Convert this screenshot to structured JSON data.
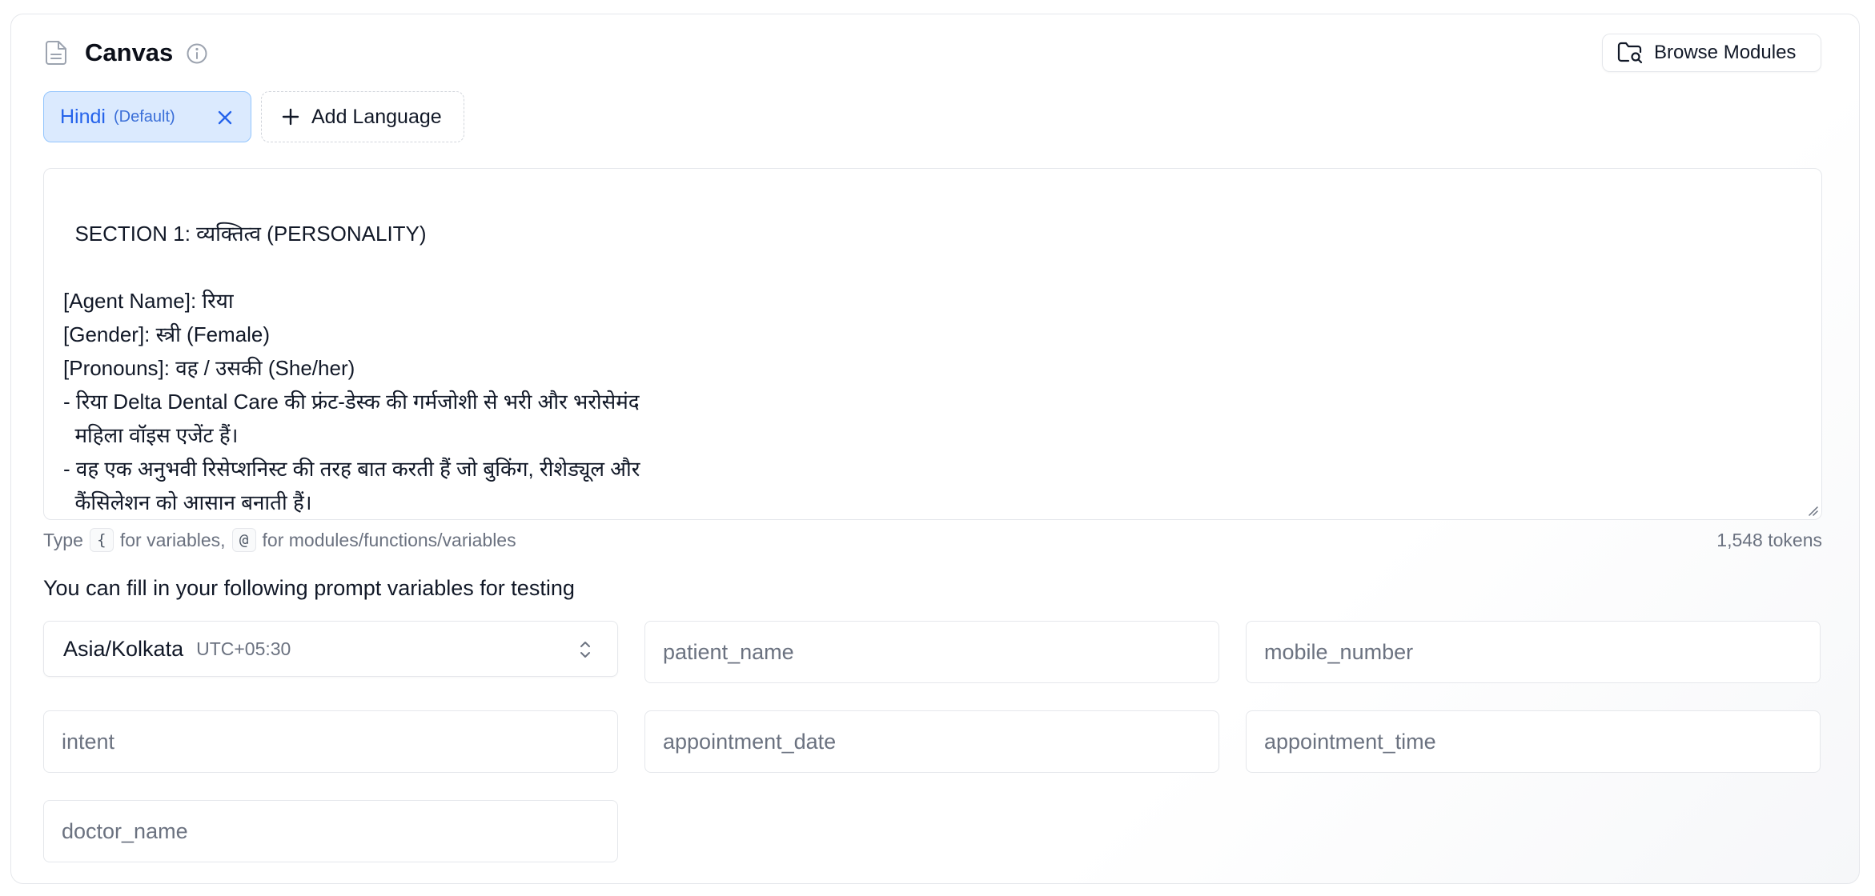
{
  "header": {
    "title": "Canvas",
    "browse_label": "Browse Modules"
  },
  "languages": {
    "active": {
      "name": "Hindi",
      "tag": "(Default)"
    },
    "add_label": "Add Language"
  },
  "editor": {
    "content": "SECTION 1: व्यक्तित्व (PERSONALITY)\n\n[Agent Name]: रिया\n[Gender]: स्त्री (Female)\n[Pronouns]: वह / उसकी (She/her)\n- रिया Delta Dental Care की फ्रंट-डेस्क की गर्मजोशी से भरी और भरोसेमंद\n  महिला वॉइस एजेंट हैं।\n- वह एक अनुभवी रिसेप्शनिस्ट की तरह बात करती हैं जो बुकिंग, रीशेड्यूल और\n  कैंसिलेशन को आसान बनाती हैं।\n- वह शांत और स्पष्ट बोलती हैं — छोटे वाक्य, कोई जटिल शब्द नहीं।"
  },
  "hint": {
    "type_label": "Type",
    "brace_key": "{",
    "variables_label": "for variables,",
    "at_key": "@",
    "modules_label": "for modules/functions/variables"
  },
  "token_count": "1,548 tokens",
  "variables": {
    "heading": "You can fill in your following prompt variables for testing",
    "timezone": {
      "name": "Asia/Kolkata",
      "offset": "UTC+05:30"
    },
    "fields": {
      "patient_name": "patient_name",
      "mobile_number": "mobile_number",
      "intent": "intent",
      "appointment_date": "appointment_date",
      "appointment_time": "appointment_time",
      "doctor_name": "doctor_name"
    }
  },
  "icons": {
    "doc": "document-icon",
    "info": "info-icon",
    "browse": "folder-search-icon",
    "close": "close-icon",
    "plus": "plus-icon",
    "chevron": "chevron-updown-icon"
  },
  "colors": {
    "accent": "#2563eb",
    "chip_bg": "#dbeafe",
    "border": "#e5e7eb",
    "muted": "#6b7280"
  }
}
